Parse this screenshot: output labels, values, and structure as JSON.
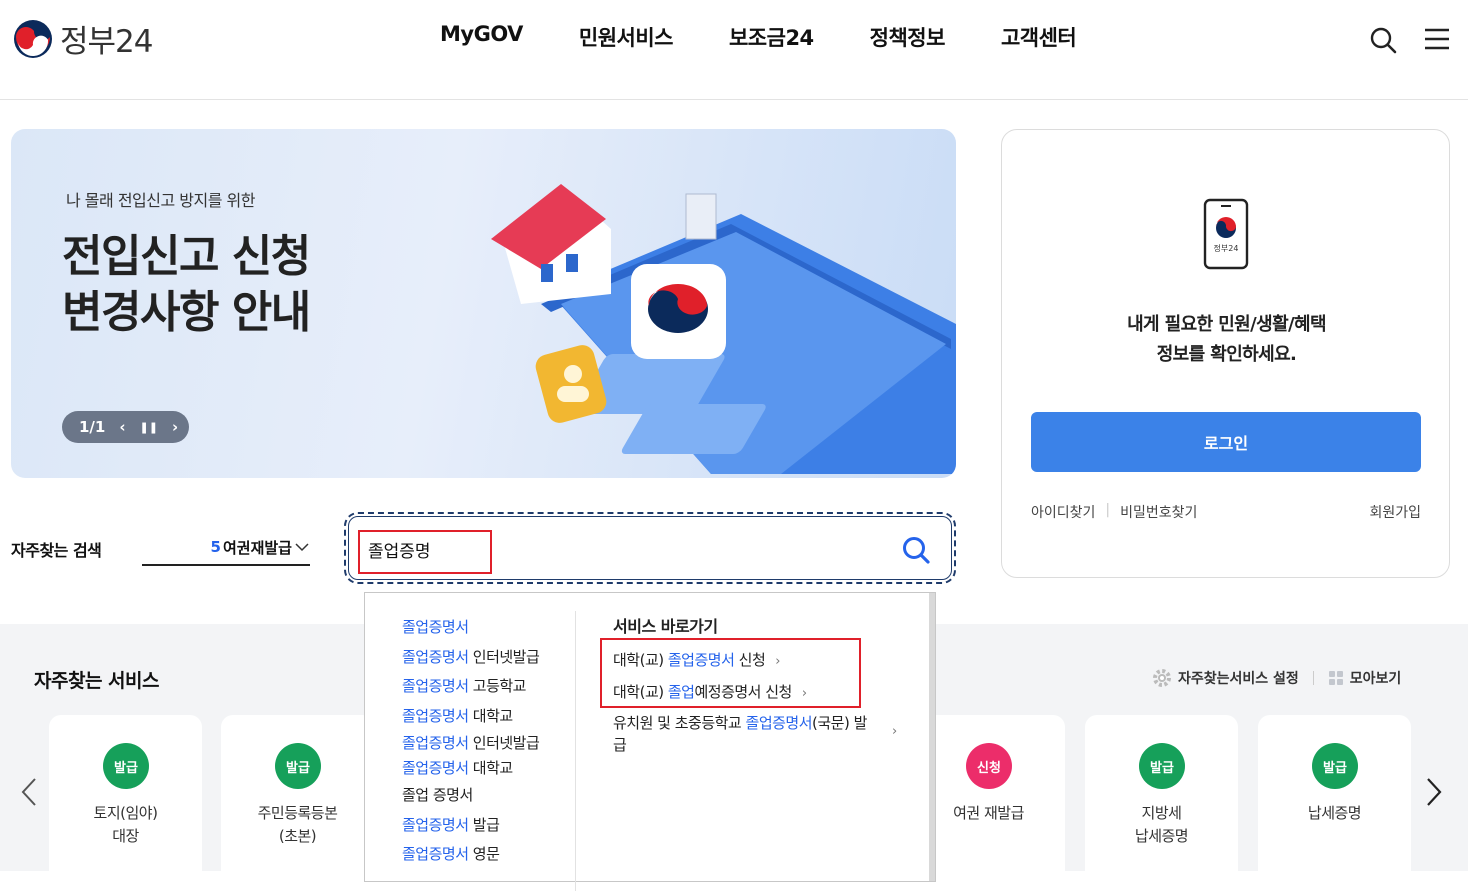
{
  "header": {
    "logo_text": "정부24",
    "nav": [
      "MyGOV",
      "민원서비스",
      "보조금24",
      "정책정보",
      "고객센터"
    ]
  },
  "banner": {
    "subtitle": "나 몰래 전입신고 방지를 위한",
    "title_line1": "전입신고 신청",
    "title_line2": "변경사항 안내",
    "pager": "1/1"
  },
  "login": {
    "message": "내게 필요한 민원/생활/혜택\n정보를 확인하세요.",
    "login_button": "로그인",
    "find_id": "아이디찾기",
    "find_pw": "비밀번호찾기",
    "join": "회원가입",
    "phone_icon_text": "정부24"
  },
  "search": {
    "frequent_label": "자주찾는 검색",
    "frequent_rank": "5",
    "frequent_term": "여권재발급",
    "query": "졸업증명"
  },
  "suggestions": [
    {
      "kw": "졸업증명서",
      "rest": ""
    },
    {
      "kw": "졸업증명서",
      "rest": " 인터넷발급"
    },
    {
      "kw": "졸업증명서",
      "rest": " 고등학교"
    },
    {
      "kw": "졸업증명서",
      "rest": " 대학교"
    },
    {
      "kw": "졸업증명서",
      "rest": " 인터넷발급"
    },
    {
      "kw": "졸업증명서",
      "rest": " 대학교"
    },
    {
      "kw": "",
      "rest": "졸업 증명서"
    },
    {
      "kw": "졸업증명서",
      "rest": " 발급"
    },
    {
      "kw": "졸업증명서",
      "rest": " 영문"
    }
  ],
  "quick": {
    "title": "서비스 바로가기",
    "items": [
      {
        "pre": "대학(교) ",
        "kw": "졸업증명서",
        "post": " 신청"
      },
      {
        "pre": "대학(교) ",
        "kw": "졸업",
        "post": "예정증명서 신청"
      },
      {
        "pre": "유치원 및 초중등학교 ",
        "kw": "졸업증명서",
        "post": "(국문) 발\n급"
      }
    ]
  },
  "services": {
    "title": "자주찾는 서비스",
    "settings": "자주찾는서비스 설정",
    "collect": "모아보기",
    "colors": {
      "issue": "#16a05a",
      "apply": "#ec2d6a"
    },
    "cards": [
      {
        "badge": "발급",
        "type": "issue",
        "name": "토지(임야)\n대장"
      },
      {
        "badge": "발급",
        "type": "issue",
        "name": "주민등록등본\n(초본)"
      },
      {
        "badge": "신청",
        "type": "apply",
        "name": "여권 재발급"
      },
      {
        "badge": "발급",
        "type": "issue",
        "name": "지방세\n납세증명"
      },
      {
        "badge": "발급",
        "type": "issue",
        "name": "납세증명"
      }
    ]
  }
}
